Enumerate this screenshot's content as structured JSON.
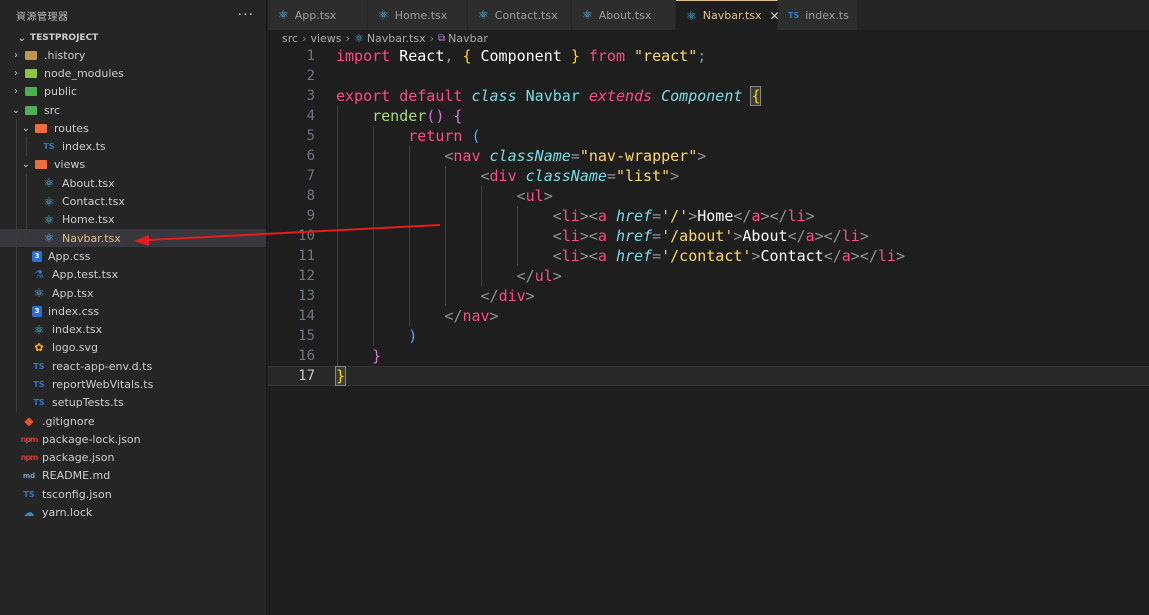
{
  "sidebar": {
    "title": "資源管理器",
    "more": "···",
    "project": "TESTPROJECT",
    "items": [
      {
        "label": ".history",
        "kind": "folder",
        "chevron": "›",
        "color": "#c09553",
        "icon": "folder-icon"
      },
      {
        "label": "node_modules",
        "kind": "folder",
        "chevron": "›",
        "color": "#8bc34a",
        "icon": "node-folder-icon"
      },
      {
        "label": "public",
        "kind": "folder",
        "chevron": "›",
        "color": "#4caf50",
        "icon": "public-folder-icon"
      },
      {
        "label": "src",
        "kind": "folder",
        "chevron": "⌄",
        "color": "#4caf50",
        "icon": "src-folder-icon"
      },
      {
        "label": "routes",
        "kind": "folder",
        "chevron": "⌄",
        "color": "#ef6c3b",
        "icon": "routes-folder-icon"
      },
      {
        "label": "index.ts",
        "kind": "ts",
        "icon": "typescript-icon"
      },
      {
        "label": "views",
        "kind": "folder",
        "chevron": "⌄",
        "color": "#ef6c3b",
        "icon": "views-folder-icon"
      },
      {
        "label": "About.tsx",
        "kind": "react",
        "icon": "react-icon"
      },
      {
        "label": "Contact.tsx",
        "kind": "react",
        "icon": "react-icon"
      },
      {
        "label": "Home.tsx",
        "kind": "react",
        "icon": "react-icon"
      },
      {
        "label": "Navbar.tsx",
        "kind": "react",
        "icon": "react-icon"
      },
      {
        "label": "App.css",
        "kind": "css",
        "icon": "css-icon"
      },
      {
        "label": "App.test.tsx",
        "kind": "test",
        "icon": "test-icon"
      },
      {
        "label": "App.tsx",
        "kind": "react",
        "icon": "react-icon"
      },
      {
        "label": "index.css",
        "kind": "css",
        "icon": "css-icon"
      },
      {
        "label": "index.tsx",
        "kind": "react",
        "icon": "react-icon"
      },
      {
        "label": "logo.svg",
        "kind": "svg",
        "icon": "svg-icon"
      },
      {
        "label": "react-app-env.d.ts",
        "kind": "ts",
        "icon": "typescript-icon"
      },
      {
        "label": "reportWebVitals.ts",
        "kind": "ts",
        "icon": "typescript-icon"
      },
      {
        "label": "setupTests.ts",
        "kind": "ts",
        "icon": "typescript-icon"
      },
      {
        "label": ".gitignore",
        "kind": "git",
        "icon": "git-icon"
      },
      {
        "label": "package-lock.json",
        "kind": "json",
        "icon": "npm-icon"
      },
      {
        "label": "package.json",
        "kind": "json",
        "icon": "npm-icon"
      },
      {
        "label": "README.md",
        "kind": "md",
        "icon": "markdown-icon"
      },
      {
        "label": "tsconfig.json",
        "kind": "ts",
        "icon": "typescript-icon"
      },
      {
        "label": "yarn.lock",
        "kind": "yarn",
        "icon": "yarn-icon"
      }
    ]
  },
  "tabs": [
    {
      "label": "App.tsx",
      "icon": "⚛",
      "active": false
    },
    {
      "label": "Home.tsx",
      "icon": "⚛",
      "active": false
    },
    {
      "label": "Contact.tsx",
      "icon": "⚛",
      "active": false
    },
    {
      "label": "About.tsx",
      "icon": "⚛",
      "active": false
    },
    {
      "label": "Navbar.tsx",
      "icon": "⚛",
      "active": true,
      "close": "✕"
    },
    {
      "label": "index.ts",
      "icon": "TS",
      "active": false
    }
  ],
  "breadcrumb": {
    "parts": [
      "src",
      "views",
      "Navbar.tsx",
      "Navbar"
    ],
    "sep": "›"
  },
  "glyphs": {
    "ts": "TS",
    "react": "⚛",
    "css": "3",
    "svg": "✿",
    "json": "npm",
    "md": "md",
    "git": "◆",
    "yarn": "☁",
    "test": "⚗"
  },
  "code": {
    "current_line": 17,
    "lines": [
      {
        "n": "1"
      },
      {
        "n": "2"
      },
      {
        "n": "3"
      },
      {
        "n": "4"
      },
      {
        "n": "5"
      },
      {
        "n": "6"
      },
      {
        "n": "7"
      },
      {
        "n": "8"
      },
      {
        "n": "9"
      },
      {
        "n": "10"
      },
      {
        "n": "11"
      },
      {
        "n": "12"
      },
      {
        "n": "13"
      },
      {
        "n": "14"
      },
      {
        "n": "15"
      },
      {
        "n": "16"
      },
      {
        "n": "17"
      }
    ],
    "tokens": {
      "import": "import",
      "react_id": "React",
      "component": "Component",
      "from": "from",
      "react_str": "\"react\"",
      "export": "export",
      "default": "default",
      "class": "class",
      "navbar": "Navbar",
      "extends": "extends",
      "render": "render",
      "return": "return",
      "nav": "nav",
      "div": "div",
      "ul": "ul",
      "li": "li",
      "a": "a",
      "className": "className",
      "href": "href",
      "nav_cls": "\"nav-wrapper\"",
      "div_cls": "\"list\"",
      "href_home": "'/'",
      "href_about": "'/about'",
      "href_contact": "'/contact'",
      "home": "Home",
      "about": "About",
      "contact": "Contact"
    }
  },
  "colors": {
    "accent": "#e2c08d",
    "arrow": "#e51c1c"
  }
}
